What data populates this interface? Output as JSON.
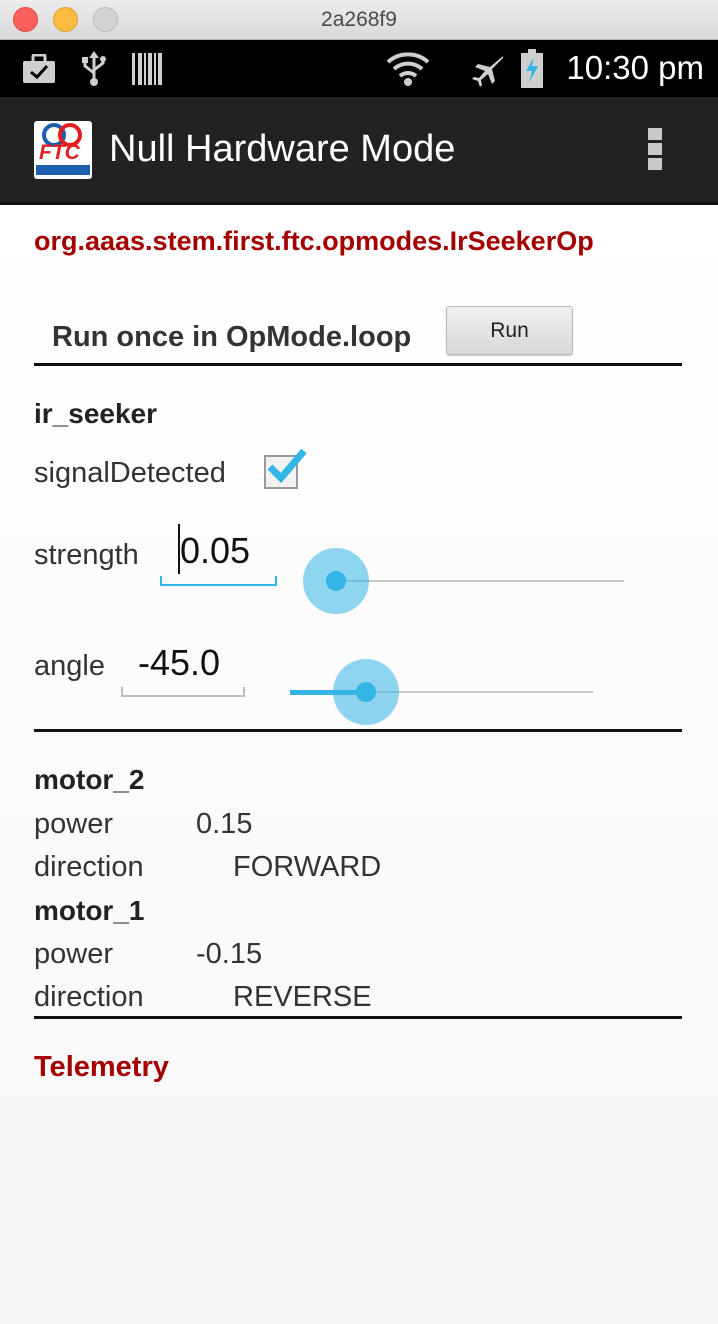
{
  "window": {
    "title": "2a268f9"
  },
  "status_bar": {
    "time": "10:30 pm",
    "icons": [
      "briefcase-icon",
      "usb-icon",
      "barcode-icon",
      "wifi-icon",
      "airplane-mode-icon",
      "battery-charging-icon"
    ]
  },
  "action_bar": {
    "title": "Null Hardware Mode",
    "logo_text": "FTC",
    "menu_icon": "overflow-menu-icon"
  },
  "opmode": {
    "name": "org.aaas.stem.first.ftc.opmodes.IrSeekerOp",
    "run_label": "Run once in OpMode.loop",
    "run_button": "Run"
  },
  "ir_seeker": {
    "name": "ir_seeker",
    "signal_label": "signalDetected",
    "signal_checked": true,
    "strength_label": "strength",
    "strength_value": "0.05",
    "strength_slider_fraction": 0.05,
    "angle_label": "angle",
    "angle_value": "-45.0",
    "angle_slider_fraction": 0.25
  },
  "motors": [
    {
      "name": "motor_2",
      "power_label": "power",
      "power": "0.15",
      "direction_label": "direction",
      "direction": "FORWARD"
    },
    {
      "name": "motor_1",
      "power_label": "power",
      "power": "-0.15",
      "direction_label": "direction",
      "direction": "REVERSE"
    }
  ],
  "telemetry": {
    "title": "Telemetry"
  },
  "colors": {
    "accent": "#33b5e5",
    "heading_red": "#a40000",
    "action_bar": "#222222"
  }
}
